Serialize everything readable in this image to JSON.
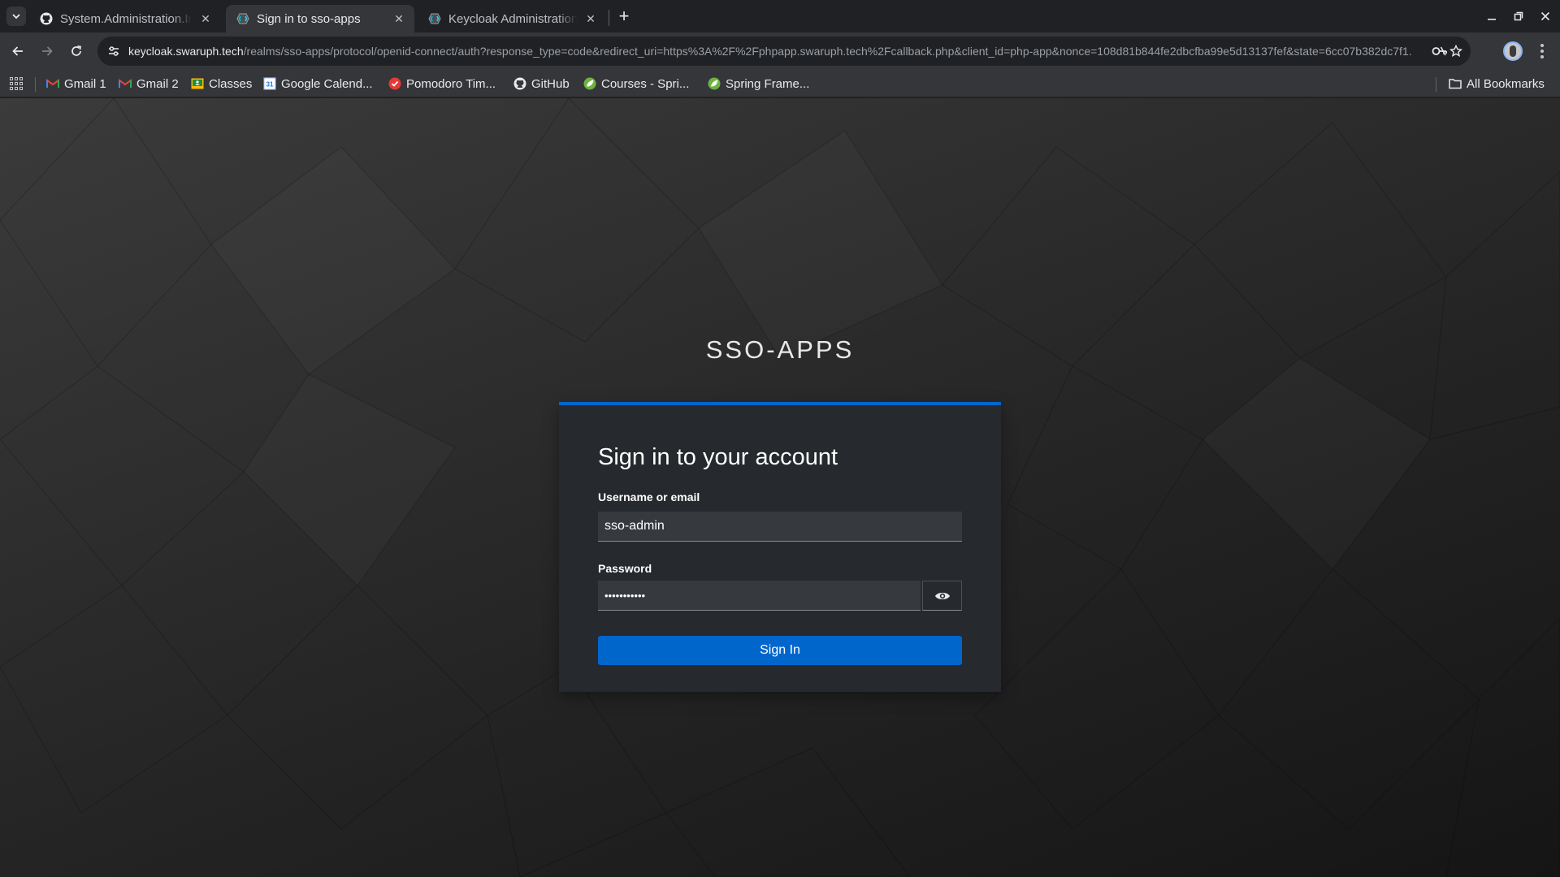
{
  "browser": {
    "tabs": [
      {
        "title": "System.Administration.In",
        "active": false
      },
      {
        "title": "Sign in to sso-apps",
        "active": true
      },
      {
        "title": "Keycloak Administration",
        "active": false
      }
    ],
    "tab_close_glyph": "✕",
    "new_tab_glyph": "+",
    "url_host": "keycloak.swaruph.tech",
    "url_path": "/realms/sso-apps/protocol/openid-connect/auth?response_type=code&redirect_uri=https%3A%2F%2Fphpapp.swaruph.tech%2Fcallback.php&client_id=php-app&nonce=108d81b844fe2dbcfba99e5d13137fef&state=6cc07b382dc7f1...",
    "bookmarks": [
      {
        "label": "Gmail 1",
        "icon": "gmail-icon"
      },
      {
        "label": "Gmail 2",
        "icon": "gmail-icon"
      },
      {
        "label": "Classes",
        "icon": "classroom-icon"
      },
      {
        "label": "Google Calend...",
        "icon": "calendar-icon"
      },
      {
        "label": "Pomodoro Tim...",
        "icon": "pomodoro-icon"
      },
      {
        "label": "GitHub",
        "icon": "github-icon"
      },
      {
        "label": "Courses - Spri...",
        "icon": "spring-icon"
      },
      {
        "label": "Spring Frame...",
        "icon": "spring-icon"
      }
    ],
    "all_bookmarks_label": "All Bookmarks",
    "calendar_icon_text": "31"
  },
  "login": {
    "realm_title": "SSO-APPS",
    "heading": "Sign in to your account",
    "username_label": "Username or email",
    "username_value": "sso-admin",
    "password_label": "Password",
    "password_value": "•••••••••••",
    "submit_label": "Sign In"
  },
  "colors": {
    "accent": "#0066cc",
    "card_bg": "#26292d",
    "input_bg": "#36393e",
    "chrome_dark": "#202124",
    "chrome_toolbar": "#35363a"
  }
}
